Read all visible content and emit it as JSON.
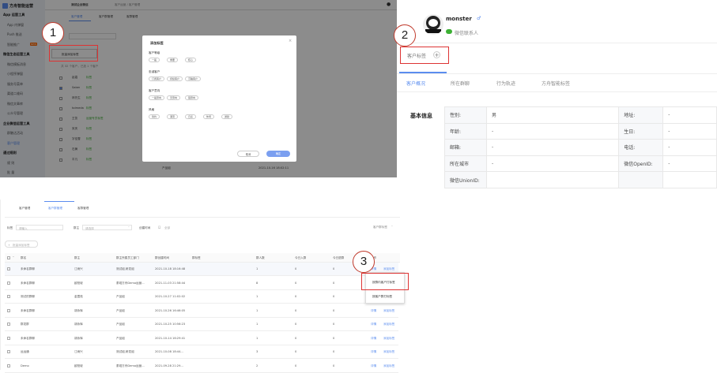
{
  "p1": {
    "brand": "方舟智能运营",
    "topbar": {
      "tenant": "测试企业微信",
      "breadcrumb": "客户运营 / 客户管理"
    },
    "tabs": [
      "客户管理",
      "客户群管理",
      "客群管理"
    ],
    "sidebar": [
      {
        "label": "App 运营工具",
        "head": true
      },
      {
        "label": "App 内弹窗"
      },
      {
        "label": "Push 推送"
      },
      {
        "label": "智能推广",
        "badge": "NEW"
      },
      {
        "label": "微信生态运营工具",
        "head": true
      },
      {
        "label": "微信模板消息"
      },
      {
        "label": "小程序弹窗"
      },
      {
        "label": "服务号菜单"
      },
      {
        "label": "渠道二维码"
      },
      {
        "label": "微信文章库"
      },
      {
        "label": "公众号管理"
      },
      {
        "label": "企业微信运营工具",
        "head": true
      },
      {
        "label": "群触达活动"
      },
      {
        "label": "客户管理",
        "active": true
      },
      {
        "label": "通过规则",
        "head": true
      },
      {
        "label": "规 则"
      },
      {
        "label": "批 量"
      }
    ],
    "filter_label": "标签",
    "add_button": "批量添加标签",
    "selection_text": "共 32 个客户，已选 1 个客户",
    "rows": [
      {
        "name": "赵嘉",
        "tag": "标签"
      },
      {
        "name": "Saber",
        "tag": "标签"
      },
      {
        "name": "林先生",
        "tag": "标签"
      },
      {
        "name": "tolmeda",
        "tag": "标签"
      },
      {
        "name": "王凯",
        "tag": "运营专员标签"
      },
      {
        "name": "宋庆",
        "tag": "标签"
      },
      {
        "name": "字佳雪",
        "tag": "标签"
      },
      {
        "name": "石黄",
        "tag": "标签"
      },
      {
        "name": "平凡",
        "tag": "标签"
      }
    ],
    "last_row": {
      "dept": "产品组",
      "time": "2021-10-16 18:02:11"
    },
    "modal": {
      "title": "添加标签",
      "groups": [
        {
          "title": "客户等级",
          "tags": [
            "一般",
            "重要",
            "核心"
          ]
        },
        {
          "title": "忠诚客户",
          "tags": [
            "订阅客户",
            "持续客户",
            "沉睡客户"
          ]
        },
        {
          "title": "客户意向",
          "tags": [
            "一般意向",
            "无意向",
            "强意向"
          ]
        },
        {
          "title": "风格",
          "tags": [
            "简约",
            "潮流",
            "日系",
            "休闲",
            "通勤"
          ]
        }
      ],
      "cancel": "取消",
      "confirm": "确定"
    },
    "marker": "1"
  },
  "p2": {
    "name": "monster",
    "wechat": "微信联系人",
    "tag_label": "客户标签",
    "add_symbol": "+",
    "marker": "2",
    "tabs": [
      "客户概况",
      "所在群聊",
      "行为轨迹",
      "方舟智能标签"
    ],
    "section": "基本信息",
    "fields": [
      [
        "性别:",
        "男",
        "地址:",
        "-"
      ],
      [
        "年龄:",
        "-",
        "生日:",
        "-"
      ],
      [
        "邮箱:",
        "-",
        "电话:",
        "-"
      ],
      [
        "所在城市",
        "-",
        "微信OpenID:",
        "-"
      ],
      [
        "微信UnionID:",
        "",
        "",
        ""
      ]
    ]
  },
  "p3": {
    "tabs": [
      "客户管理",
      "客户群管理",
      "客群管理"
    ],
    "filters": {
      "tag": "标签",
      "tag_ph": "请输入",
      "owner": "群主",
      "owner_ph": "请选择",
      "time": "创建时间",
      "date_ph": "全部",
      "right": "客户群标签"
    },
    "batch_button": "批量添加标签",
    "columns": [
      "群名",
      "群主",
      "群主所属员工部门",
      "群创建时间",
      "群标签",
      "群人数",
      "今日入群",
      "今日退群",
      "操作"
    ],
    "rows": [
      {
        "name": "未命名群聊",
        "owner": "江雨兴",
        "dept": "测试组,研发组",
        "time": "2021-10-18 18:16:48",
        "count": "1",
        "today_in": "0",
        "today_out": "0"
      },
      {
        "name": "未命名群聊",
        "owner": "欧阳坡",
        "dept": "泰观方舟Demo运营...",
        "time": "2021-11-03 21:58:44",
        "count": "8",
        "today_in": "0",
        "today_out": "0"
      },
      {
        "name": "测试的群聊",
        "owner": "金霞苑",
        "dept": "产品组",
        "time": "2021-10-27 11:02:02",
        "count": "1",
        "today_in": "0",
        "today_out": "0"
      },
      {
        "name": "未命名群聊",
        "owner": "胡永辉",
        "dept": "产品组",
        "time": "2021-10-26 16:46:05",
        "count": "1",
        "today_in": "0",
        "today_out": "0"
      },
      {
        "name": "群发群",
        "owner": "胡永辉",
        "dept": "产品组",
        "time": "2021-10-25 10:56:23",
        "count": "1",
        "today_in": "0",
        "today_out": "0"
      },
      {
        "name": "未命名群聊",
        "owner": "胡永辉",
        "dept": "产品组",
        "time": "2021-10-14 16:29:41",
        "count": "1",
        "today_in": "0",
        "today_out": "0"
      },
      {
        "name": "运运通",
        "owner": "江雨兴",
        "dept": "测试组,研发组",
        "time": "2021-10-08 18:44...",
        "count": "3",
        "today_in": "0",
        "today_out": "0"
      },
      {
        "name": "Demo",
        "owner": "欧阳坡",
        "dept": "泰观方舟Demo运营...",
        "time": "2021-09-28 21:29...",
        "count": "2",
        "today_in": "0",
        "today_out": "0"
      }
    ],
    "action_detail": "详情",
    "action_tag": "添加标签",
    "menu": [
      "按群内客户打标签",
      "按客户群打标签"
    ],
    "marker": "3"
  },
  "colors": {
    "accent": "#5b8def",
    "marker_red": "#c0392b"
  }
}
